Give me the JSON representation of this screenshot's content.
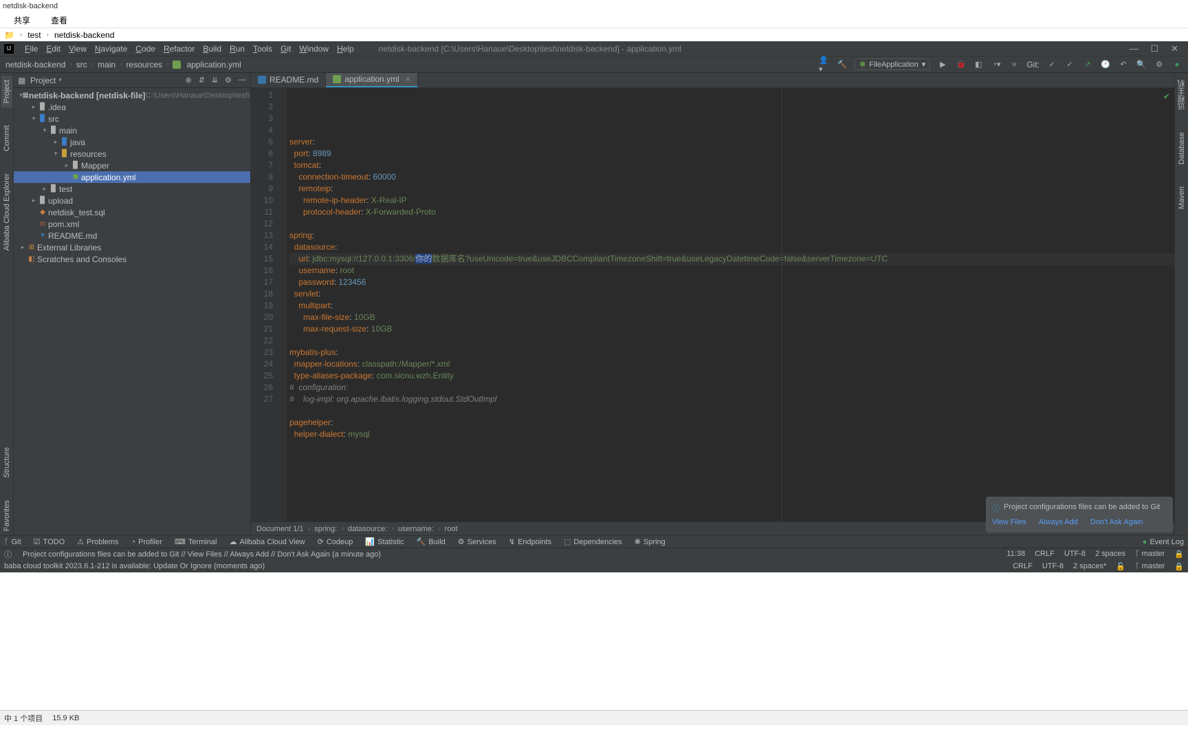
{
  "window": {
    "title": "netdisk-backend",
    "share": "共享",
    "view": "查看"
  },
  "explorer": {
    "path1": "test",
    "path2": "netdisk-backend"
  },
  "ide": {
    "menus": [
      "File",
      "Edit",
      "View",
      "Navigate",
      "Code",
      "Refactor",
      "Build",
      "Run",
      "Tools",
      "Git",
      "Window",
      "Help"
    ],
    "title_path": "netdisk-backend [C:\\Users\\Hanaue\\Desktop\\test\\netdisk-backend] - application.yml",
    "breadcrumb": [
      "netdisk-backend",
      "src",
      "main",
      "resources",
      "application.yml"
    ],
    "run_config": "FileApplication",
    "git_label": "Git:"
  },
  "project": {
    "title": "Project",
    "root": "netdisk-backend",
    "root_bold": " [netdisk-file]",
    "root_path": "  C:\\Users\\Hanaue\\Desktop\\test\\ne",
    "nodes": {
      "idea": ".idea",
      "src": "src",
      "main": "main",
      "java": "java",
      "resources": "resources",
      "mapper": "Mapper",
      "appyml": "application.yml",
      "test": "test",
      "upload": "upload",
      "sql": "netdisk_test.sql",
      "pom": "pom.xml",
      "readme": "README.md",
      "ext": "External Libraries",
      "scratch": "Scratches and Consoles"
    }
  },
  "tabs": {
    "readme": "README.md",
    "appyml": "application.yml"
  },
  "gutter": {
    "left": {
      "project": "Project",
      "commit": "Commit",
      "alibaba": "Alibaba Cloud Explorer",
      "structure": "Structure",
      "favorites": "Favorites"
    },
    "right": {
      "remote": "远程主机",
      "db": "Database",
      "maven": "Maven"
    }
  },
  "chart_data": {
    "type": "table",
    "title": "application.yml",
    "lines": [
      {
        "n": 1,
        "raw": "server:",
        "seg": [
          {
            "t": "server",
            "c": "key"
          },
          {
            "t": ":"
          }
        ]
      },
      {
        "n": 2,
        "raw": "  port: 8989",
        "seg": [
          {
            "t": "  "
          },
          {
            "t": "port",
            "c": "key"
          },
          {
            "t": ": "
          },
          {
            "t": "8989",
            "c": "num"
          }
        ]
      },
      {
        "n": 3,
        "raw": "  tomcat:",
        "seg": [
          {
            "t": "  "
          },
          {
            "t": "tomcat",
            "c": "key"
          },
          {
            "t": ":"
          }
        ]
      },
      {
        "n": 4,
        "raw": "    connection-timeout: 60000",
        "seg": [
          {
            "t": "    "
          },
          {
            "t": "connection-timeout",
            "c": "key"
          },
          {
            "t": ": "
          },
          {
            "t": "60000",
            "c": "num"
          }
        ]
      },
      {
        "n": 5,
        "raw": "    remoteip:",
        "seg": [
          {
            "t": "    "
          },
          {
            "t": "remoteip",
            "c": "key"
          },
          {
            "t": ":"
          }
        ]
      },
      {
        "n": 6,
        "raw": "      remote-ip-header: X-Real-IP",
        "seg": [
          {
            "t": "      "
          },
          {
            "t": "remote-ip-header",
            "c": "key"
          },
          {
            "t": ": "
          },
          {
            "t": "X-Real-IP",
            "c": "str"
          }
        ]
      },
      {
        "n": 7,
        "raw": "      protocol-header: X-Forwarded-Proto",
        "seg": [
          {
            "t": "      "
          },
          {
            "t": "protocol-header",
            "c": "key"
          },
          {
            "t": ": "
          },
          {
            "t": "X-Forwarded-Proto",
            "c": "str"
          }
        ]
      },
      {
        "n": 8,
        "raw": "",
        "seg": []
      },
      {
        "n": 9,
        "raw": "spring:",
        "seg": [
          {
            "t": "spring",
            "c": "key"
          },
          {
            "t": ":"
          }
        ]
      },
      {
        "n": 10,
        "raw": "  datasource:",
        "seg": [
          {
            "t": "  "
          },
          {
            "t": "datasource",
            "c": "key"
          },
          {
            "t": ":"
          }
        ]
      },
      {
        "n": 11,
        "raw": "    url: jdbc:mysql://127.0.0.1:3306/你的数据库名?useUnicode=true&useJDBCCompliantTimezoneShift=true&useLegacyDatetimeCode=false&serverTimezone=UTC",
        "current": true,
        "seg": [
          {
            "t": "    "
          },
          {
            "t": "url",
            "c": "key"
          },
          {
            "t": ": "
          },
          {
            "t": "jdbc:mysql://127.0.0.1:3306/",
            "c": "str"
          },
          {
            "t": "你的",
            "c": "sel"
          },
          {
            "t": "数据库名?useUnicode=true&useJDBCCompliantTimezoneShift=true&useLegacyDatetimeCode=false&serverTimezone=UTC",
            "c": "str"
          }
        ]
      },
      {
        "n": 12,
        "raw": "    username: root",
        "seg": [
          {
            "t": "    "
          },
          {
            "t": "username",
            "c": "key"
          },
          {
            "t": ": "
          },
          {
            "t": "root",
            "c": "str"
          }
        ]
      },
      {
        "n": 13,
        "raw": "    password: 123456",
        "seg": [
          {
            "t": "    "
          },
          {
            "t": "password",
            "c": "key"
          },
          {
            "t": ": "
          },
          {
            "t": "123456",
            "c": "num"
          }
        ]
      },
      {
        "n": 14,
        "raw": "  servlet:",
        "seg": [
          {
            "t": "  "
          },
          {
            "t": "servlet",
            "c": "key"
          },
          {
            "t": ":"
          }
        ]
      },
      {
        "n": 15,
        "raw": "    multipart:",
        "seg": [
          {
            "t": "    "
          },
          {
            "t": "multipart",
            "c": "key"
          },
          {
            "t": ":"
          }
        ]
      },
      {
        "n": 16,
        "raw": "      max-file-size: 10GB",
        "seg": [
          {
            "t": "      "
          },
          {
            "t": "max-file-size",
            "c": "key"
          },
          {
            "t": ": "
          },
          {
            "t": "10GB",
            "c": "str"
          }
        ]
      },
      {
        "n": 17,
        "raw": "      max-request-size: 10GB",
        "seg": [
          {
            "t": "      "
          },
          {
            "t": "max-request-size",
            "c": "key"
          },
          {
            "t": ": "
          },
          {
            "t": "10GB",
            "c": "str"
          }
        ]
      },
      {
        "n": 18,
        "raw": "",
        "seg": []
      },
      {
        "n": 19,
        "raw": "mybatis-plus:",
        "seg": [
          {
            "t": "mybatis-plus",
            "c": "key"
          },
          {
            "t": ":"
          }
        ]
      },
      {
        "n": 20,
        "raw": "  mapper-locations: classpath:/Mapper/*.xml",
        "seg": [
          {
            "t": "  "
          },
          {
            "t": "mapper-locations",
            "c": "key"
          },
          {
            "t": ": "
          },
          {
            "t": "classpath:/Mapper/*.xml",
            "c": "str"
          }
        ]
      },
      {
        "n": 21,
        "raw": "  type-aliases-package: com.sicnu.wzh.Entity",
        "seg": [
          {
            "t": "  "
          },
          {
            "t": "type-aliases-package",
            "c": "key"
          },
          {
            "t": ": "
          },
          {
            "t": "com.sicnu.wzh.Entity",
            "c": "str"
          }
        ]
      },
      {
        "n": 22,
        "raw": "#  configuration:",
        "seg": [
          {
            "t": "#  configuration:",
            "c": "cmt"
          }
        ]
      },
      {
        "n": 23,
        "raw": "#    log-impl: org.apache.ibatis.logging.stdout.StdOutImpl",
        "seg": [
          {
            "t": "#    log-impl: org.apache.ibatis.logging.stdout.StdOutImpl",
            "c": "cmt"
          }
        ]
      },
      {
        "n": 24,
        "raw": "",
        "seg": []
      },
      {
        "n": 25,
        "raw": "pagehelper:",
        "seg": [
          {
            "t": "pagehelper",
            "c": "key"
          },
          {
            "t": ":"
          }
        ]
      },
      {
        "n": 26,
        "raw": "  helper-dialect: mysql",
        "seg": [
          {
            "t": "  "
          },
          {
            "t": "helper-dialect",
            "c": "key"
          },
          {
            "t": ": "
          },
          {
            "t": "mysql",
            "c": "str"
          }
        ]
      },
      {
        "n": 27,
        "raw": "",
        "seg": []
      }
    ]
  },
  "editor_breadcrumb": [
    "Document 1/1",
    "spring:",
    "datasource:",
    "username:",
    "root"
  ],
  "notification": {
    "title": "Project configurations files can be added to Git",
    "links": [
      "View Files",
      "Always Add",
      "Don't Ask Again"
    ]
  },
  "bottom_bar": [
    "Git",
    "TODO",
    "Problems",
    "Profiler",
    "Terminal",
    "Alibaba Cloud View",
    "Codeup",
    "Statistic",
    "Build",
    "Services",
    "Endpoints",
    "Dependencies",
    "Spring"
  ],
  "bottom_bar_event": "Event Log",
  "status1": {
    "msg": "Project configurations files can be added to Git // View Files // Always Add // Don't Ask Again (a minute ago)",
    "right": [
      "11:38",
      "CRLF",
      "UTF-8",
      "2 spaces",
      "master"
    ]
  },
  "status2": {
    "msg": "baba cloud toolkit 2023.6.1-212 is available: Update Or Ignore (moments ago)",
    "right": [
      "CRLF",
      "UTF-8",
      "2 spaces*",
      "master"
    ]
  },
  "footer": {
    "items": "中 1 个项目",
    "size": "15.9 KB"
  }
}
